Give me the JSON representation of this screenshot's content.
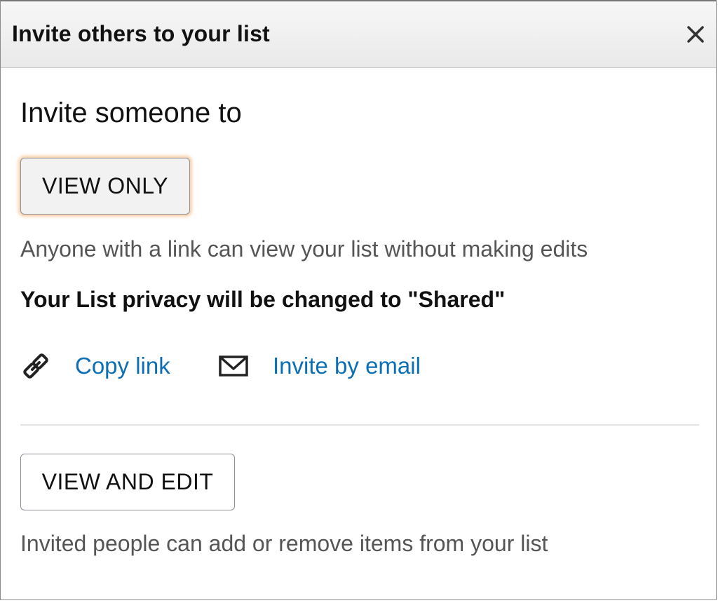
{
  "header": {
    "title": "Invite others to your list",
    "close_icon": "close-icon"
  },
  "main": {
    "heading": "Invite someone to",
    "view_only": {
      "label": "VIEW ONLY",
      "description": "Anyone with a link can view your list without making edits",
      "privacy_note": "Your List privacy will be changed to \"Shared\"",
      "selected": true
    },
    "actions": [
      {
        "icon": "link-icon",
        "label": "Copy link"
      },
      {
        "icon": "envelope-icon",
        "label": "Invite by email"
      }
    ],
    "view_and_edit": {
      "label": "VIEW AND EDIT",
      "description": "Invited people can add or remove items from your list"
    }
  },
  "colors": {
    "link": "#0b6fb5",
    "selected_glow": "#f2aa64",
    "header_bg": "#efefef"
  }
}
